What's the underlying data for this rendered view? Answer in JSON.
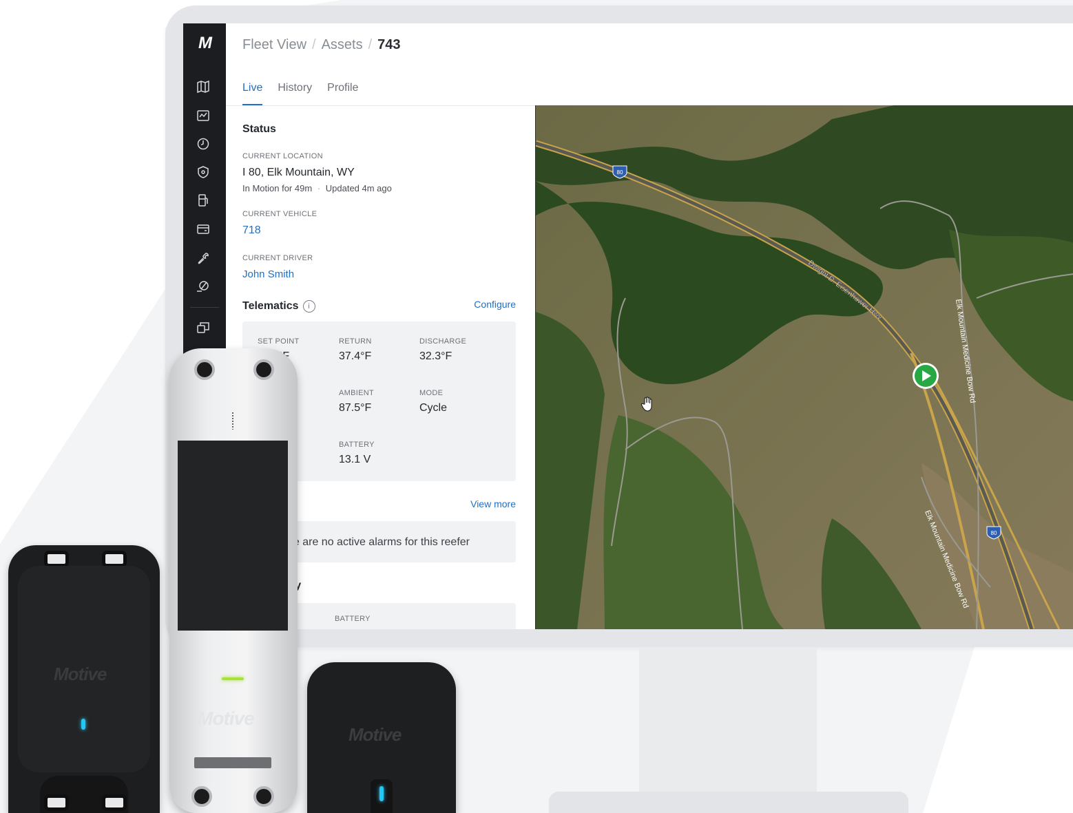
{
  "app": {
    "logo": "M"
  },
  "breadcrumb": {
    "item1": "Fleet View",
    "sep": "/",
    "item2": "Assets",
    "current": "743"
  },
  "tabs": {
    "live": "Live",
    "history": "History",
    "profile": "Profile"
  },
  "sidebar": {
    "icons": [
      "map-icon",
      "dashboard-icon",
      "clock-icon",
      "shield-icon",
      "fuel-icon",
      "card-icon",
      "wrench-icon",
      "location-off-icon",
      "windows-icon"
    ]
  },
  "status": {
    "heading": "Status",
    "location_label": "CURRENT LOCATION",
    "location_value": "I 80, Elk Mountain, WY",
    "motion": "In Motion for 49m",
    "dot": "·",
    "updated": "Updated 4m ago",
    "vehicle_label": "CURRENT VEHICLE",
    "vehicle_value": "718",
    "driver_label": "CURRENT DRIVER",
    "driver_value": "John Smith"
  },
  "telematics": {
    "heading": "Telematics",
    "info_glyph": "i",
    "configure": "Configure",
    "set_point_label": "SET POINT",
    "set_point_value": "°F",
    "return_label": "RETURN",
    "return_value": "37.4°F",
    "discharge_label": "DISCHARGE",
    "discharge_value": "32.3°F",
    "ambient_label": "AMBIENT",
    "ambient_value": "87.5°F",
    "mode_label": "MODE",
    "mode_value": "Cycle",
    "battery_label": "BATTERY",
    "battery_value": "13.1 V"
  },
  "alarms": {
    "view_more": "View more",
    "empty_text": "e are no active alarms for this reefer"
  },
  "gateway": {
    "heading": "eway",
    "battery_label": "BATTERY"
  },
  "map": {
    "highway_label": "Dwight D. Eisenhower Hwy",
    "road_label_1": "Elk Mountain Medicine Bow Rd",
    "road_label_2": "Elk Mountain Medicine Bow Rd",
    "shield_1": "80",
    "shield_2": "80",
    "marker_color": "#27a844"
  },
  "devices": {
    "brand": "Motive"
  },
  "colors": {
    "accent": "#1f6fc2",
    "sidebar": "#1b1d21",
    "led_blue": "#25c6f2",
    "led_green": "#a6e23a"
  }
}
